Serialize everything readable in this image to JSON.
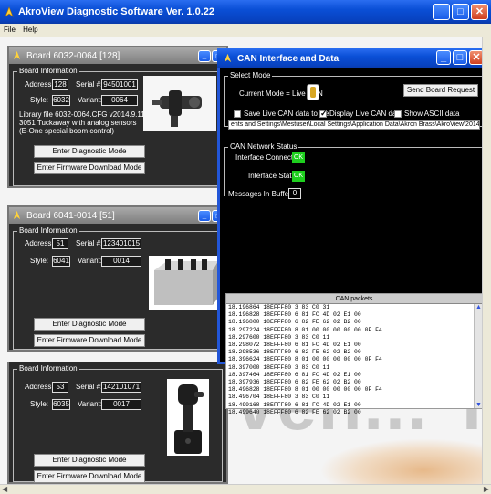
{
  "app": {
    "title": "AkroView Diagnostic Software Ver. 1.0.22",
    "menu": [
      "File",
      "Help"
    ]
  },
  "background": {
    "logo_text": "ven... Truste"
  },
  "boards": [
    {
      "title": "Board 6032-0064 [128]",
      "group_label": "Board Information",
      "address_label": "Address:",
      "address": "128",
      "serial_label": "Serial #:",
      "serial": "94501001",
      "style_label": "Style:",
      "style": "6032",
      "variant_label": "Variant:",
      "variant": "0064",
      "info_lines": [
        "Library file 6032-0064.CFG v2014.9.11.0",
        "3051 Tuckaway with analog sensors",
        "(E-One special boom control)"
      ],
      "diag_button": "Enter Diagnostic Mode",
      "firmware_button": "Enter Firmware Download Mode"
    },
    {
      "title": "Board 6041-0014 [51]",
      "group_label": "Board Information",
      "address_label": "Address:",
      "address": "51",
      "serial_label": "Serial #:",
      "serial": "123401015",
      "style_label": "Style:",
      "style": "6041",
      "variant_label": "Variant:",
      "variant": "0014",
      "diag_button": "Enter Diagnostic Mode",
      "firmware_button": "Enter Firmware Download Mode"
    },
    {
      "group_label": "Board Information",
      "address_label": "Address:",
      "address": "53",
      "serial_label": "Serial #:",
      "serial": "142101071",
      "style_label": "Style:",
      "style": "6035",
      "variant_label": "Variant:",
      "variant": "0017",
      "diag_button": "Enter Diagnostic Mode",
      "firmware_button": "Enter Firmware Download Mode"
    }
  ],
  "can": {
    "title": "CAN Interface and Data",
    "select_mode_label": "Select Mode",
    "current_mode": "Current Mode = Live CAN",
    "send_button": "Send Board Request",
    "save_label": "Save Live CAN data to file",
    "display_label": "Display Live CAN data",
    "ascii_label": "Show ASCII data",
    "path": "ents and Settings\\Mestuser\\Local Settings\\Application Data\\Akron Brass\\AkroView\\2014-Sep-19_132054.txt",
    "network_label": "CAN Network Status",
    "iface_conn_label": "Interface Connection",
    "iface_conn_val": "OK",
    "iface_status_label": "Interface Status",
    "iface_status_val": "OK",
    "msgs_label": "Messages In Buffer",
    "msgs_val": "0",
    "packets_header": "CAN packets",
    "packets": [
      "18.196864 18EFFF80 3 83 C0 31",
      "18.196828 18EFFF80 6 81 FC 4D 02 E1 00",
      "18.196800 18EFFF80 6 82 FE 62 02 B2 00",
      "18.297224 18EFFF80 8 01 00 00 00 00 00 0F F4",
      "18.297600 18EFFF80 3 83 C0 11",
      "18.298072 18EFFF80 6 81 FC 4D 02 E1 00",
      "18.298536 18EFFF80 6 82 FE 62 02 B2 00",
      "18.396624 18EFFF80 8 01 00 00 00 00 00 0F F4",
      "18.397000 18EFFF80 3 83 C0 11",
      "18.397464 18EFFF80 6 81 FC 4D 02 E1 00",
      "18.397936 18EFFF80 6 82 FE 62 02 B2 00",
      "18.496828 18EFFF80 8 01 00 00 00 00 00 0F F4",
      "18.496704 18EFFF80 3 83 C0 11",
      "18.499168 18EFFF80 6 81 FC 4D 02 E1 00",
      "18.499640 18EFFF80 6 82 FE 62 02 B2 00"
    ]
  }
}
